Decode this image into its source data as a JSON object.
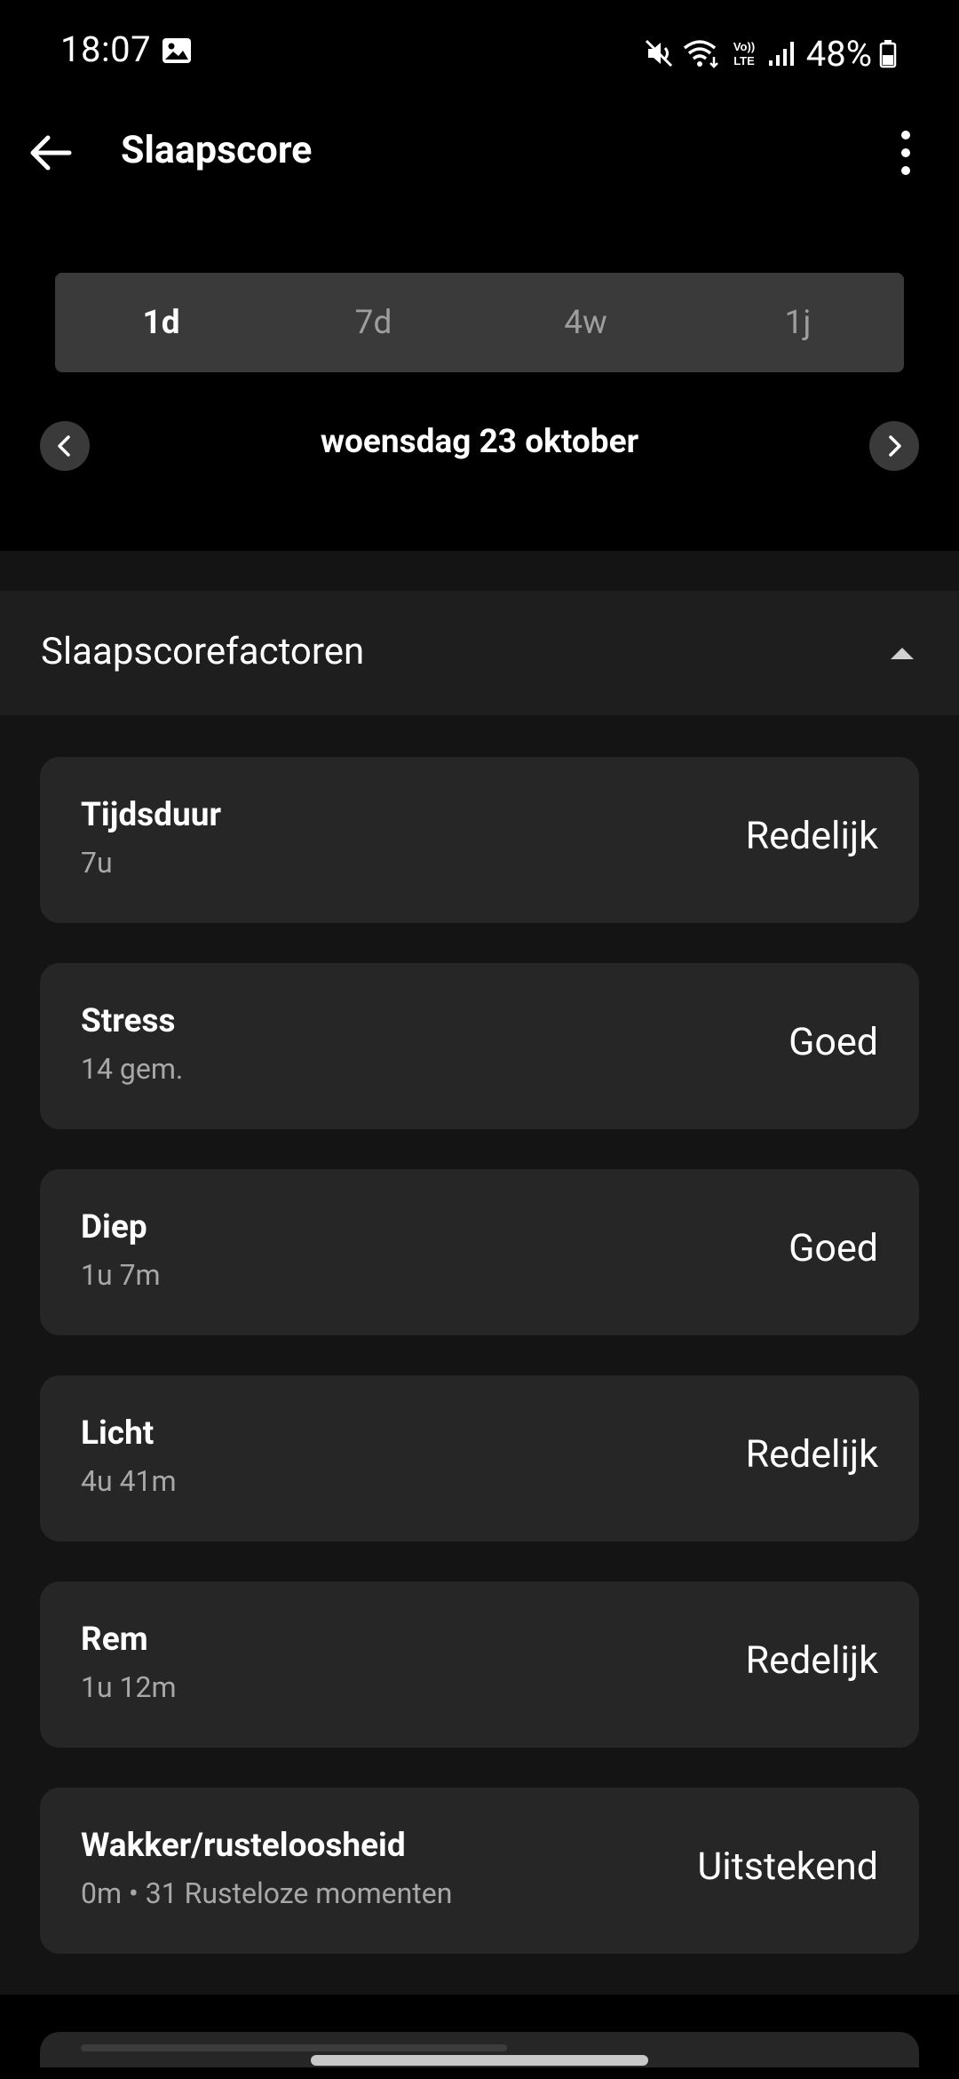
{
  "status_bar": {
    "time": "18:07",
    "battery": "48%",
    "icons": [
      "image-icon",
      "mute-icon",
      "wifi-icon",
      "volte-icon",
      "signal-icon",
      "battery-icon"
    ]
  },
  "app_bar": {
    "title": "Slaapscore"
  },
  "period_tabs": {
    "items": [
      {
        "label": "1d",
        "active": true
      },
      {
        "label": "7d",
        "active": false
      },
      {
        "label": "4w",
        "active": false
      },
      {
        "label": "1j",
        "active": false
      }
    ]
  },
  "date_nav": {
    "date": "woensdag 23 oktober"
  },
  "section": {
    "title": "Slaapscorefactoren",
    "expanded": true
  },
  "factors": [
    {
      "name": "Tijdsduur",
      "value": "7u",
      "rating": "Redelijk"
    },
    {
      "name": "Stress",
      "value": "14 gem.",
      "rating": "Goed"
    },
    {
      "name": "Diep",
      "value": "1u 7m",
      "rating": "Goed"
    },
    {
      "name": "Licht",
      "value": "4u 41m",
      "rating": "Redelijk"
    },
    {
      "name": "Rem",
      "value": "1u 12m",
      "rating": "Redelijk"
    },
    {
      "name": "Wakker/rusteloosheid",
      "value": "0m • 31 Rusteloze momenten",
      "rating": "Uitstekend"
    }
  ],
  "colors": {
    "background": "#000000",
    "section_bg": "#141414",
    "card_bg": "#262626",
    "tab_bg": "#3a3a3a",
    "secondary_text": "#a8a8a8"
  }
}
